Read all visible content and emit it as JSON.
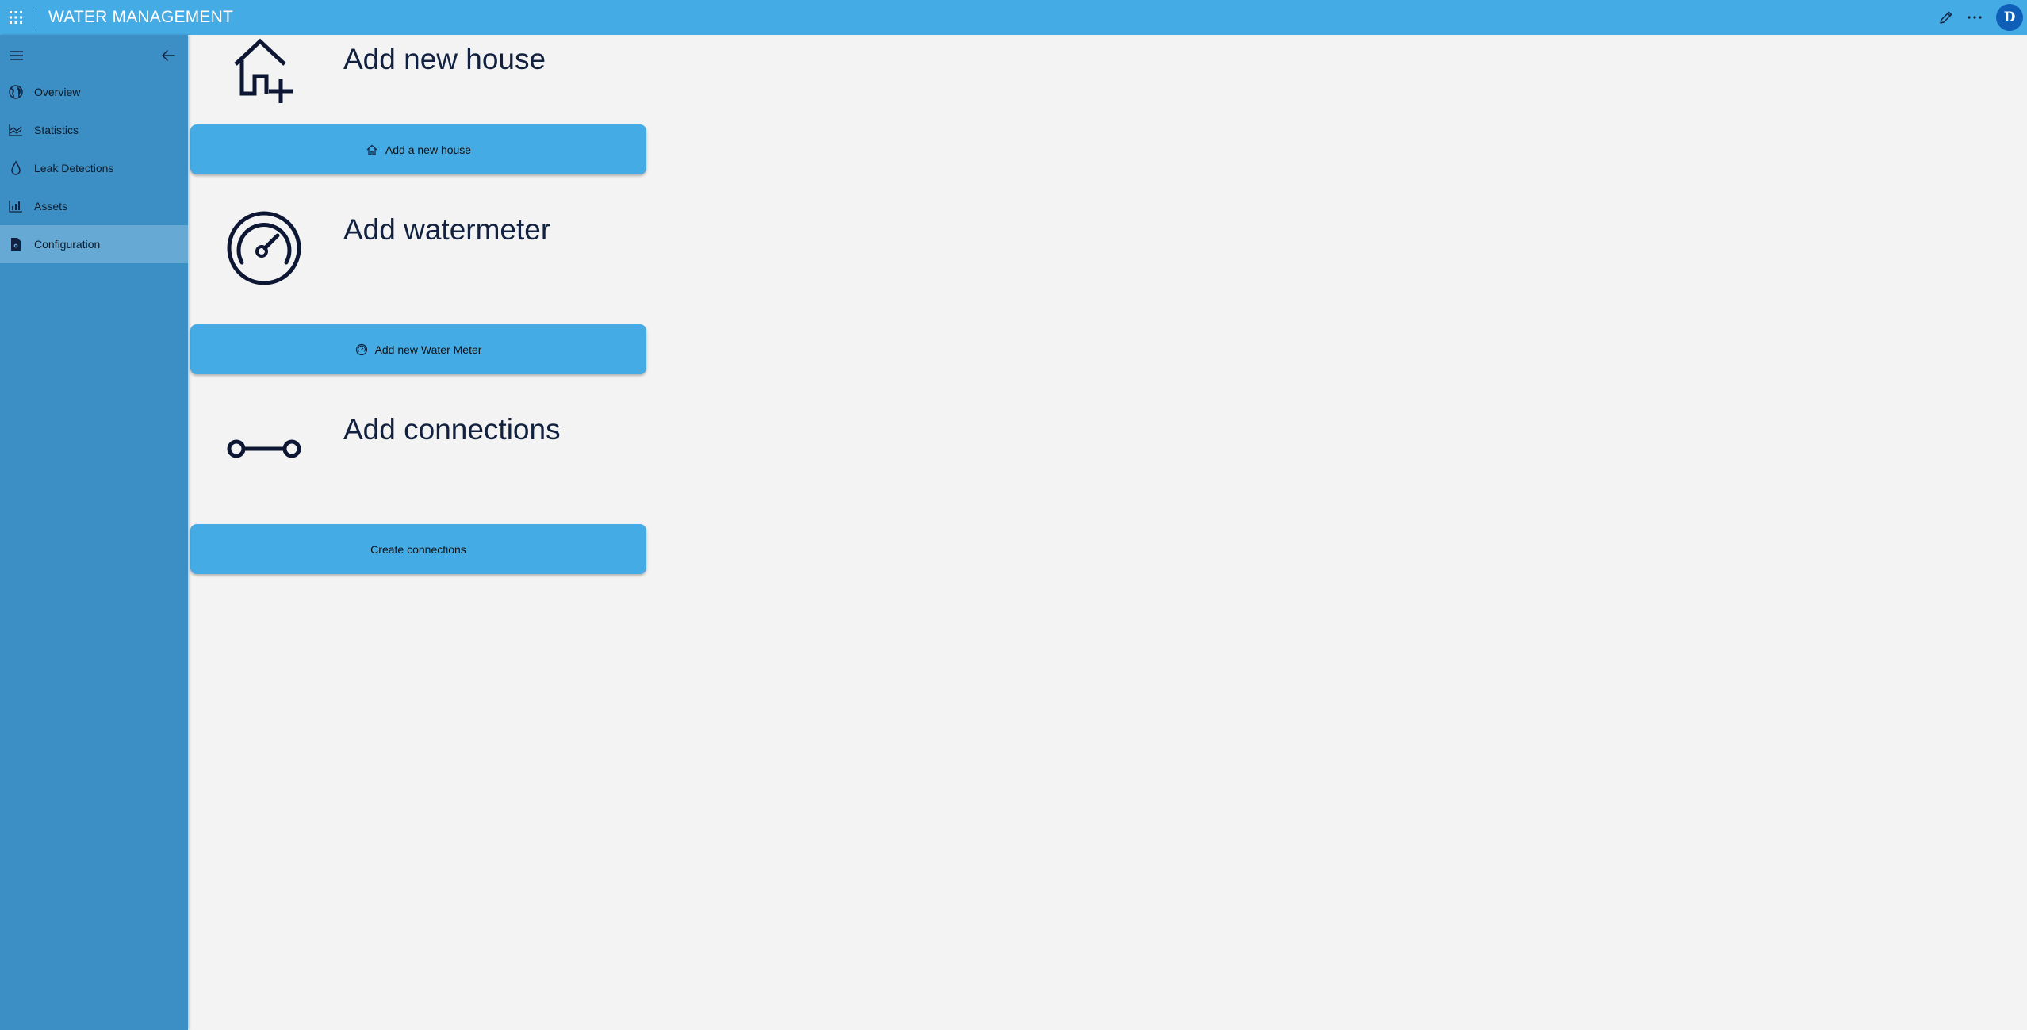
{
  "app": {
    "title": "WATER MANAGEMENT",
    "user_initial": "D"
  },
  "topbar": {
    "icons": [
      "app-launcher-icon",
      "edit-icon",
      "more-icon"
    ]
  },
  "sidebar": {
    "items": [
      {
        "label": "Overview",
        "icon": "globe-icon",
        "active": false
      },
      {
        "label": "Statistics",
        "icon": "line-chart-icon",
        "active": false
      },
      {
        "label": "Leak Detections",
        "icon": "water-drop-icon",
        "active": false
      },
      {
        "label": "Assets",
        "icon": "bar-chart-icon",
        "active": false
      },
      {
        "label": "Configuration",
        "icon": "config-document-icon",
        "active": true
      }
    ]
  },
  "sections": [
    {
      "title": "Add new house",
      "icon": "house-add-icon",
      "button_label": "Add a new house",
      "button_icon": "house-icon"
    },
    {
      "title": "Add watermeter",
      "icon": "gauge-icon",
      "button_label": "Add new Water Meter",
      "button_icon": "gauge-small-icon"
    },
    {
      "title": "Add connections",
      "icon": "connection-icon",
      "button_label": "Create connections",
      "button_icon": ""
    }
  ],
  "colors": {
    "topbar": "#45abe5",
    "sidebar": "#3b8fc4",
    "sidebar_active": "#66a9d4",
    "button": "#45abe5",
    "background": "#f3f3f3",
    "avatar": "#0f5fb8",
    "heading_text": "#12213f"
  }
}
